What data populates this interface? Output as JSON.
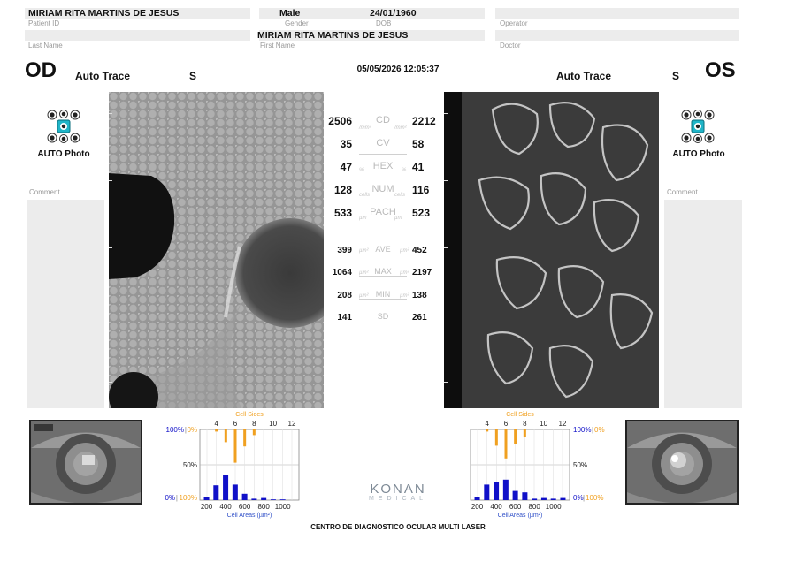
{
  "header": {
    "patient_name": "MIRIAM RITA MARTINS DE JESUS",
    "patient_id_label": "Patient ID",
    "gender": "Male",
    "gender_label": "Gender",
    "dob": "24/01/1960",
    "dob_label": "DOB",
    "operator_label": "Operator",
    "last_name_label": "Last Name",
    "first_name": "MIRIAM RITA MARTINS DE JESUS",
    "first_name_label": "First Name",
    "doctor_label": "Doctor"
  },
  "od": {
    "label": "OD",
    "trace": "Auto Trace",
    "s": "S",
    "photo_label": "AUTO Photo",
    "comment_label": "Comment"
  },
  "os": {
    "label": "OS",
    "trace": "Auto Trace",
    "s": "S",
    "photo_label": "AUTO Photo",
    "comment_label": "Comment"
  },
  "datetime": "05/05/2026 12:05:37",
  "metrics": [
    {
      "name": "CD",
      "od": "2506",
      "os": "2212",
      "unit": "/mm²"
    },
    {
      "name": "CV",
      "od": "35",
      "os": "58",
      "unit": ""
    },
    {
      "name": "HEX",
      "od": "47",
      "os": "41",
      "unit": "%"
    },
    {
      "name": "NUM",
      "od": "128",
      "os": "116",
      "unit": "cells"
    },
    {
      "name": "PACH",
      "od": "533",
      "os": "523",
      "unit": "µm"
    },
    {
      "name": "AVE",
      "od": "399",
      "os": "452",
      "unit": "µm²"
    },
    {
      "name": "MAX",
      "od": "1064",
      "os": "2197",
      "unit": "µm²"
    },
    {
      "name": "MIN",
      "od": "208",
      "os": "138",
      "unit": "µm²"
    },
    {
      "name": "SD",
      "od": "141",
      "os": "261",
      "unit": ""
    }
  ],
  "chart_data": [
    {
      "type": "bar",
      "eye": "OD",
      "title": "Cell Sides",
      "xlabel": "Cell Areas (µm²)",
      "sides_ticks": [
        "4",
        "6",
        "8",
        "10",
        "12"
      ],
      "area_ticks": [
        "200",
        "400",
        "600",
        "800",
        "1000"
      ],
      "left_axis_top": "100%",
      "left_axis_top_alt": "0%",
      "mid_label": "50%",
      "left_axis_bottom": "0%",
      "left_axis_bottom_alt": "100%",
      "sides": {
        "categories": [
          3,
          4,
          5,
          6,
          7,
          8,
          9,
          10,
          11,
          12
        ],
        "values": [
          0,
          3,
          18,
          47,
          24,
          8,
          0,
          0,
          0,
          0
        ]
      },
      "areas": {
        "categories": [
          200,
          300,
          400,
          500,
          600,
          700,
          800,
          900,
          1000,
          1100
        ],
        "values": [
          5,
          21,
          36,
          22,
          9,
          2,
          3,
          1,
          1,
          0
        ]
      },
      "colors": {
        "sides": "#f0a020",
        "areas": "#1010c8"
      }
    },
    {
      "type": "bar",
      "eye": "OS",
      "title": "Cell Sides",
      "xlabel": "Cell Areas (µm²)",
      "sides_ticks": [
        "4",
        "6",
        "8",
        "10",
        "12"
      ],
      "area_ticks": [
        "200",
        "400",
        "600",
        "800",
        "1000"
      ],
      "right_axis_top": "100%",
      "right_axis_top_alt": "0%",
      "mid_label": "50%",
      "right_axis_bottom": "0%",
      "right_axis_bottom_alt": "100%",
      "sides": {
        "categories": [
          3,
          4,
          5,
          6,
          7,
          8,
          9,
          10,
          11,
          12
        ],
        "values": [
          0,
          3,
          23,
          41,
          20,
          10,
          0,
          0,
          0,
          0
        ]
      },
      "areas": {
        "categories": [
          200,
          300,
          400,
          500,
          600,
          700,
          800,
          900,
          1000,
          1100
        ],
        "values": [
          4,
          22,
          25,
          29,
          13,
          11,
          2,
          3,
          2,
          3
        ]
      },
      "colors": {
        "sides": "#f0a020",
        "areas": "#1010c8"
      }
    }
  ],
  "brand": {
    "logo": "KONAN",
    "sub": "MEDICAL"
  },
  "footer": "CENTRO DE DIAGNOSTICO OCULAR MULTI LASER"
}
